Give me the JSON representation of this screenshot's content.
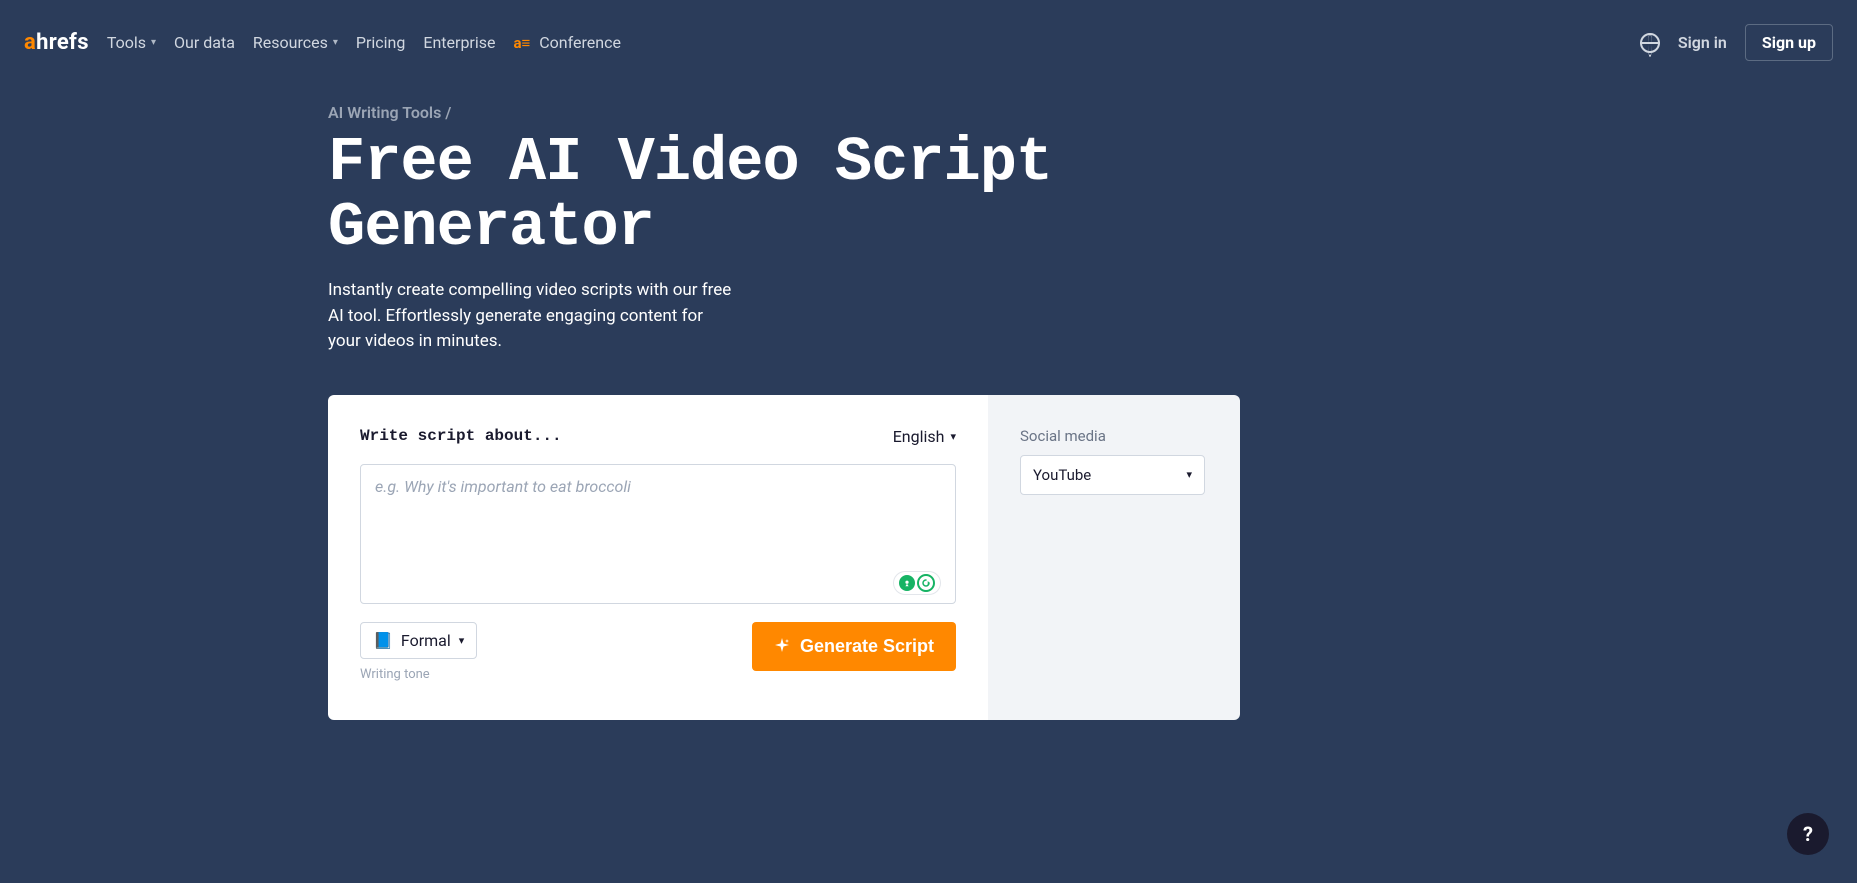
{
  "header": {
    "logo_a": "a",
    "logo_rest": "hrefs",
    "nav": {
      "tools": "Tools",
      "our_data": "Our data",
      "resources": "Resources",
      "pricing": "Pricing",
      "enterprise": "Enterprise",
      "conference": "Conference"
    },
    "signin": "Sign in",
    "signup": "Sign up"
  },
  "breadcrumb": {
    "parent": "AI Writing Tools",
    "sep": " /"
  },
  "page_title": "Free AI Video Script Generator",
  "subtitle": "Instantly create compelling video scripts with our free AI tool. Effortlessly generate engaging content for your videos in minutes.",
  "form": {
    "label": "Write script about...",
    "language": "English",
    "placeholder": "e.g. Why it's important to eat broccoli",
    "tone_emoji": "📘",
    "tone_value": "Formal",
    "tone_caption": "Writing tone",
    "generate_label": "Generate Script"
  },
  "sidebar": {
    "social_label": "Social media",
    "social_value": "YouTube"
  },
  "help": "?"
}
